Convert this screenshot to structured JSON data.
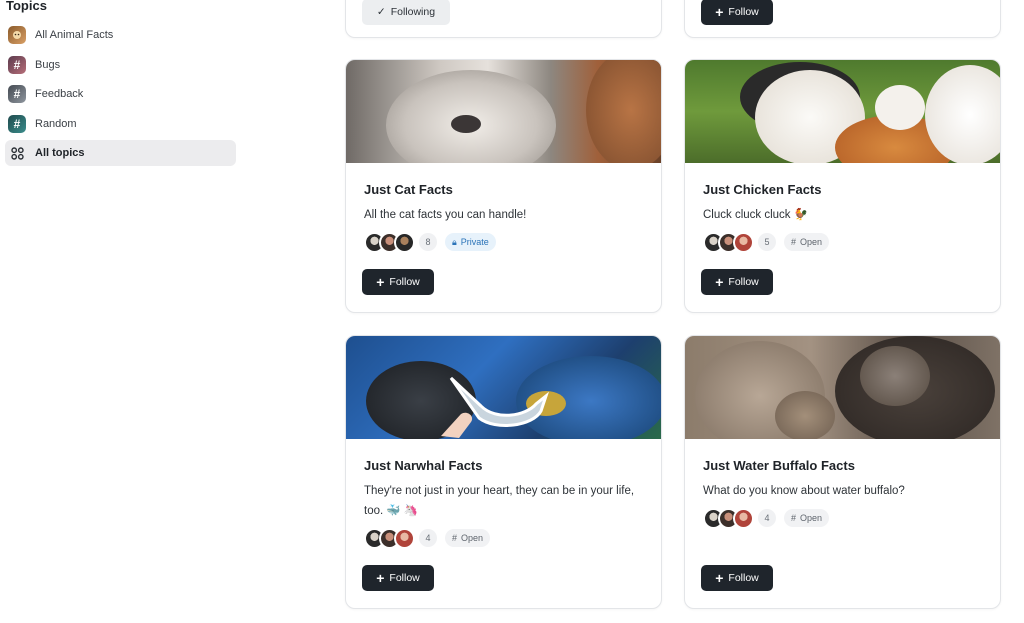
{
  "sidebar": {
    "heading": "Topics",
    "items": [
      {
        "label": "All Animal Facts",
        "icon": "animal-avatar-icon"
      },
      {
        "label": "Bugs",
        "icon": "hash-icon"
      },
      {
        "label": "Feedback",
        "icon": "hash-icon"
      },
      {
        "label": "Random",
        "icon": "hash-icon"
      },
      {
        "label": "All topics",
        "icon": "grid-icon"
      }
    ]
  },
  "top_cards": {
    "left": {
      "button": "Following",
      "check": "✓"
    },
    "right": {
      "button": "Follow",
      "plus": "+"
    }
  },
  "cards": [
    {
      "title": "Just Cat Facts",
      "description": "All the cat facts you can handle!",
      "member_count": "8",
      "visibility": "Private",
      "button": "Follow",
      "banner_icon": "cat-photo"
    },
    {
      "title": "Just Chicken Facts",
      "description": "Cluck cluck cluck 🐓",
      "member_count": "5",
      "visibility": "Open",
      "button": "Follow",
      "banner_icon": "chicken-photo"
    },
    {
      "title": "Just Narwhal Facts",
      "description": "They're not just in your heart, they can be in your life, too. 🐳 🦄",
      "member_count": "4",
      "visibility": "Open",
      "button": "Follow",
      "banner_icon": "narwhal-photo"
    },
    {
      "title": "Just Water Buffalo Facts",
      "description": "What do you know about water buffalo?",
      "member_count": "4",
      "visibility": "Open",
      "button": "Follow",
      "banner_icon": "water-buffalo-photo"
    }
  ],
  "symbols": {
    "plus": "+",
    "hash": "#",
    "lock": "🔒︎"
  },
  "colors": {
    "button_dark": "#1f252c",
    "private_tag": "#2a73b8",
    "sidebar_active_bg": "#ececee"
  }
}
